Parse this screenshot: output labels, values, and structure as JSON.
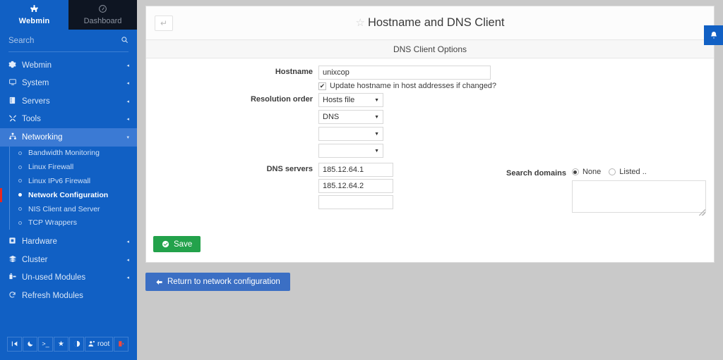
{
  "sidebar": {
    "brand": {
      "webmin_label": "Webmin",
      "webmin_icon": "webmin-logo-icon",
      "dashboard_label": "Dashboard",
      "dashboard_icon": "dashboard-icon"
    },
    "search": {
      "placeholder": "Search",
      "value": "",
      "icon": "search-icon"
    },
    "items": [
      {
        "label": "Webmin",
        "icon": "gear-icon",
        "caret": "◂"
      },
      {
        "label": "System",
        "icon": "monitor-icon",
        "caret": "◂"
      },
      {
        "label": "Servers",
        "icon": "server-icon",
        "caret": "◂"
      },
      {
        "label": "Tools",
        "icon": "tools-icon",
        "caret": "◂"
      },
      {
        "label": "Networking",
        "icon": "network-icon",
        "caret": "▾"
      }
    ],
    "sub_items": [
      {
        "label": "Bandwidth Monitoring"
      },
      {
        "label": "Linux Firewall"
      },
      {
        "label": "Linux IPv6 Firewall"
      },
      {
        "label": "Network Configuration"
      },
      {
        "label": "NIS Client and Server"
      },
      {
        "label": "TCP Wrappers"
      }
    ],
    "items_after": [
      {
        "label": "Hardware",
        "icon": "hardware-icon",
        "caret": "◂"
      },
      {
        "label": "Cluster",
        "icon": "cluster-icon",
        "caret": "◂"
      },
      {
        "label": "Un-used Modules",
        "icon": "modules-icon",
        "caret": "◂"
      },
      {
        "label": "Refresh Modules",
        "icon": "refresh-icon",
        "caret": ""
      }
    ],
    "bottom_buttons": [
      {
        "label": "⏴|",
        "name": "collapse-sidebar-icon"
      },
      {
        "label": "☾",
        "name": "dark-mode-icon"
      },
      {
        "label": ">_",
        "name": "terminal-icon"
      },
      {
        "label": "★",
        "name": "favorites-icon"
      },
      {
        "label": "◑",
        "name": "theme-palette-icon"
      },
      {
        "label": "root",
        "name": "user-root-button"
      },
      {
        "label": "➡",
        "name": "logout-icon"
      }
    ]
  },
  "header": {
    "back_icon": "↵",
    "star_icon": "☆",
    "title": "Hostname and DNS Client",
    "bell_icon": "🔔"
  },
  "form": {
    "section_title": "DNS Client Options",
    "hostname": {
      "label": "Hostname",
      "value": "unixcop"
    },
    "update_hostname": {
      "label": "Update hostname in host addresses if changed?",
      "checked": true,
      "check_glyph": "✔"
    },
    "resolution_order": {
      "label": "Resolution order",
      "selects": [
        "Hosts file",
        "DNS",
        "",
        ""
      ]
    },
    "dns_servers": {
      "label": "DNS servers",
      "values": [
        "185.12.64.1",
        "185.12.64.2",
        ""
      ]
    },
    "search_domains": {
      "label": "Search domains",
      "option_none": "None",
      "option_listed": "Listed ..",
      "selected": "None",
      "textarea_value": ""
    },
    "save_button": {
      "label": "Save",
      "icon": "✔"
    }
  },
  "footer": {
    "return_button": {
      "label": "Return to network configuration",
      "icon": "←"
    }
  },
  "colors": {
    "sidebar_blue": "#1160c4",
    "dashboard_dark": "#0e1522",
    "accent_green": "#23a24b",
    "accent_blue": "#3b6fc4",
    "active_marker_red": "#e8281e",
    "page_bg": "#c9c9c9"
  }
}
